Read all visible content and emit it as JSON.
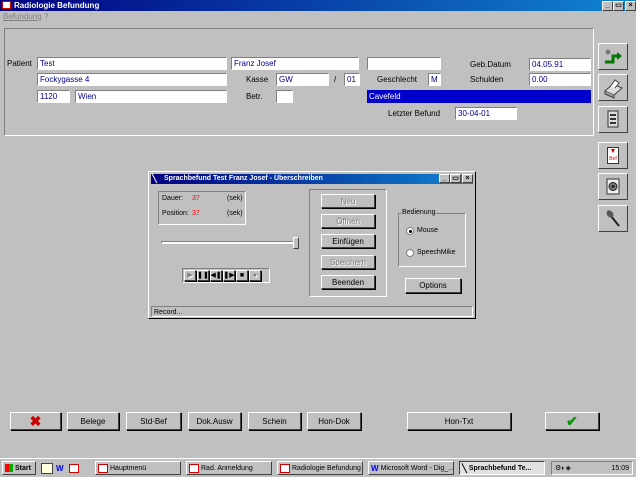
{
  "window": {
    "title": "Radiologie Befundung",
    "menu": [
      "Befundung",
      "?"
    ]
  },
  "patient": {
    "label": "Patient",
    "last_name": "Test",
    "first_name": "Franz Josef",
    "extra": "",
    "street": "Fockygasse 4",
    "zip": "1120",
    "city": "Wien",
    "kasse_label": "Kasse",
    "kasse_value": "GW",
    "kasse_sep": "/",
    "kasse_num": "01",
    "betr_label": "Betr.",
    "betr_value": "",
    "geschlecht_label": "Geschlecht",
    "geschlecht_value": "M",
    "gebdatum_label": "Geb.Datum",
    "gebdatum_value": "04.05.91",
    "schulden_label": "Schulden",
    "schulden_value": "0.00",
    "doctor": "Cavefeld",
    "letzter_label": "Letzter Befund",
    "letzter_value": "30-04-01"
  },
  "dialog": {
    "title": "Sprachbefund  Test Franz Josef - Überschreiben",
    "dauer_label": "Dauer:",
    "dauer_value": "37",
    "dauer_unit": "(sek)",
    "position_label": "Position:",
    "position_value": "37",
    "position_unit": "(sek)",
    "slider_fraction": 1.0,
    "buttons": {
      "neu": "Neu",
      "oeffnen": "Öffnen",
      "einfuegen": "Einfügen",
      "speichern": "Speichern",
      "beenden": "Beenden"
    },
    "bedienung_label": "Bedienung",
    "radio_mouse": "Mouse",
    "radio_speechmike": "SpeechMike",
    "selected_radio": "Mouse",
    "options_label": "Options",
    "status": "Record..."
  },
  "bottom_buttons": {
    "belege": "Belege",
    "stdbef": "Std-Bef",
    "dokausw": "Dok.Ausw",
    "schein": "Schein",
    "hondok": "Hon-Dok",
    "hontxt": "Hon-Txt"
  },
  "side_tools": [
    "exit-arrow-icon",
    "printer-icon",
    "document-icon",
    "befund-icon",
    "speaker-icon",
    "microphone-icon"
  ],
  "side_bef_label": "Bef",
  "taskbar": {
    "start": "Start",
    "items": [
      "Hauptmenü",
      "Rad. Anmeldung",
      "Radiologie Befundung",
      "Microsoft Word - Dig_...",
      "Sprachbefund  Te..."
    ],
    "active_index": 4,
    "clock": "15:09"
  },
  "colors": {
    "title_bar": "#000080",
    "field_text": "#00008b",
    "value_red": "#ff0000",
    "doctor_bar": "#0000cc",
    "cancel_red": "#cc0000",
    "ok_green": "#009900"
  }
}
